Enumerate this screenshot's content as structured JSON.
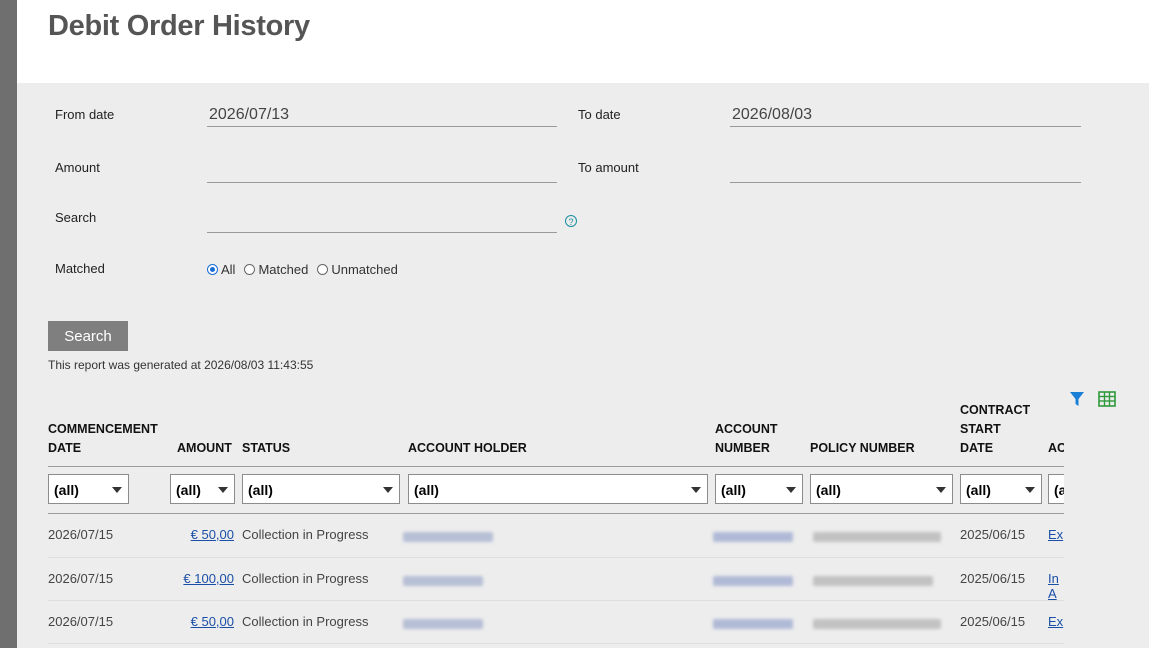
{
  "page": {
    "title": "Debit Order History"
  },
  "filters": {
    "from_date_label": "From date",
    "from_date_value": "2026/07/13",
    "to_date_label": "To date",
    "to_date_value": "2026/08/03",
    "amount_label": "Amount",
    "amount_value": "",
    "to_amount_label": "To amount",
    "to_amount_value": "",
    "search_label": "Search",
    "search_value": "",
    "help_icon": "question-circle-icon",
    "matched_label": "Matched",
    "matched_options": [
      {
        "label": "All",
        "checked": true
      },
      {
        "label": "Matched",
        "checked": false
      },
      {
        "label": "Unmatched",
        "checked": false
      }
    ]
  },
  "search_button_label": "Search",
  "report_generated_text": "This report was generated at 2026/08/03 11:43:55",
  "toolbar": {
    "filter_icon": "filter-icon",
    "export_icon": "spreadsheet-icon",
    "accent_color": "#1a7fd6",
    "export_color": "#2e9a3a"
  },
  "table": {
    "headers": [
      {
        "lines": [
          "COMMENCEMENT",
          "DATE"
        ]
      },
      {
        "lines": [
          "AMOUNT"
        ]
      },
      {
        "lines": [
          "STATUS"
        ]
      },
      {
        "lines": [
          "ACCOUNT HOLDER"
        ]
      },
      {
        "lines": [
          "ACCOUNT",
          "NUMBER"
        ]
      },
      {
        "lines": [
          "POLICY NUMBER"
        ]
      },
      {
        "lines": [
          "CONTRACT",
          "START",
          "DATE"
        ]
      },
      {
        "lines": [
          "AC"
        ]
      }
    ],
    "filter_value": "(all)",
    "rows": [
      {
        "commencement_date": "2026/07/15",
        "amount": "€ 50,00",
        "status": "Collection in Progress",
        "contract_start_date": "2025/06/15",
        "action": "Ex"
      },
      {
        "commencement_date": "2026/07/15",
        "amount": "€ 100,00",
        "status": "Collection in Progress",
        "contract_start_date": "2025/06/15",
        "action": "In A"
      },
      {
        "commencement_date": "2026/07/15",
        "amount": "€ 50,00",
        "status": "Collection in Progress",
        "contract_start_date": "2025/06/15",
        "action": "Ex"
      }
    ]
  }
}
